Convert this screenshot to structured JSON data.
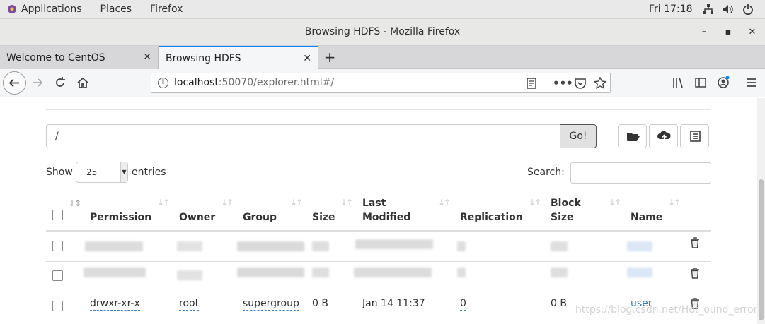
{
  "topbar": {
    "menus": [
      "Applications",
      "Places",
      "Firefox"
    ],
    "clock": "Fri 17:18"
  },
  "window": {
    "title": "Browsing HDFS - Mozilla Firefox"
  },
  "tabs": [
    {
      "label": "Welcome to CentOS",
      "active": false
    },
    {
      "label": "Browsing HDFS",
      "active": true
    }
  ],
  "navbar": {
    "url_host": "localhost",
    "url_path": ":50070/explorer.html#/"
  },
  "explorer": {
    "path_value": "/",
    "go_label": "Go!",
    "show_label": "Show",
    "entries_value": "25",
    "entries_label": "entries",
    "search_label": "Search:",
    "search_value": ""
  },
  "table": {
    "headers": {
      "permission": "Permission",
      "owner": "Owner",
      "group": "Group",
      "size": "Size",
      "last_modified_1": "Last",
      "last_modified_2": "Modified",
      "replication": "Replication",
      "block_size_1": "Block",
      "block_size_2": "Size",
      "name": "Name"
    },
    "rows": [
      {
        "permission": "",
        "owner": "",
        "group": "",
        "size": "",
        "modified": "",
        "replication": "",
        "block_size": "",
        "name": "",
        "redacted": true
      },
      {
        "permission": "",
        "owner": "",
        "group": "",
        "size": "",
        "modified": "",
        "replication": "",
        "block_size": "",
        "name": "",
        "redacted": true
      },
      {
        "permission": "drwxr-xr-x",
        "owner": "root",
        "group": "supergroup",
        "size": "0 B",
        "modified": "Jan 14 11:37",
        "replication": "0",
        "block_size": "0 B",
        "name": "user",
        "redacted": false
      }
    ]
  },
  "watermark": "https://blog.csdn.net/Hot_ound_error"
}
